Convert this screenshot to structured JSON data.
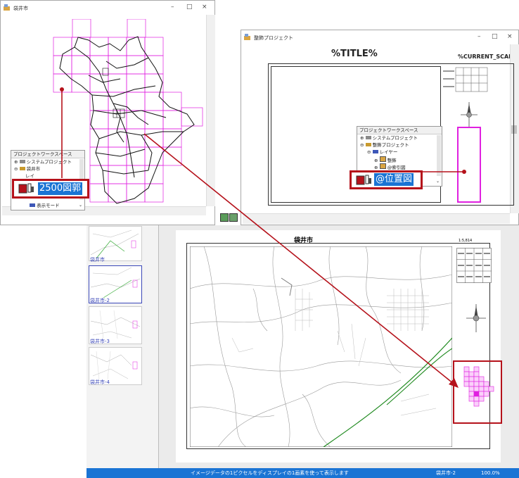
{
  "left_window": {
    "title": "袋井市",
    "workspace": {
      "header": "プロジェクトワークスペース",
      "items": [
        "システムプロジェクト",
        "袋井市",
        "レイ",
        "表示モード"
      ]
    },
    "badge_label": "2500図郭"
  },
  "right_window": {
    "title": "整飾プロジェクト",
    "sheet_title": "%TITLE%",
    "sheet_scale": "%CURRENT_SCAL",
    "workspace": {
      "header": "プロジェクトワークスペース",
      "items": [
        "システムプロジェクト",
        "整飾プロジェクト",
        "レイヤー",
        "整飾",
        "@索引図"
      ]
    },
    "badge_label": "@位置図"
  },
  "map_sheet": {
    "title": "袋井市",
    "scale": "1:5,814"
  },
  "thumbnails": [
    "袋井市",
    "袋井市-2",
    "袋井市-3",
    "袋井市-4"
  ],
  "status": {
    "message": "イメージデータの1ピクセルをディスプレイの1画素を使って表示します",
    "doc": "袋井市-2",
    "zoom": "100.0%"
  },
  "colors": {
    "accent_red": "#b5121b",
    "status_blue": "#1a74d4",
    "grid_magenta": "#e020e0",
    "road_green": "#1f8a1f"
  }
}
